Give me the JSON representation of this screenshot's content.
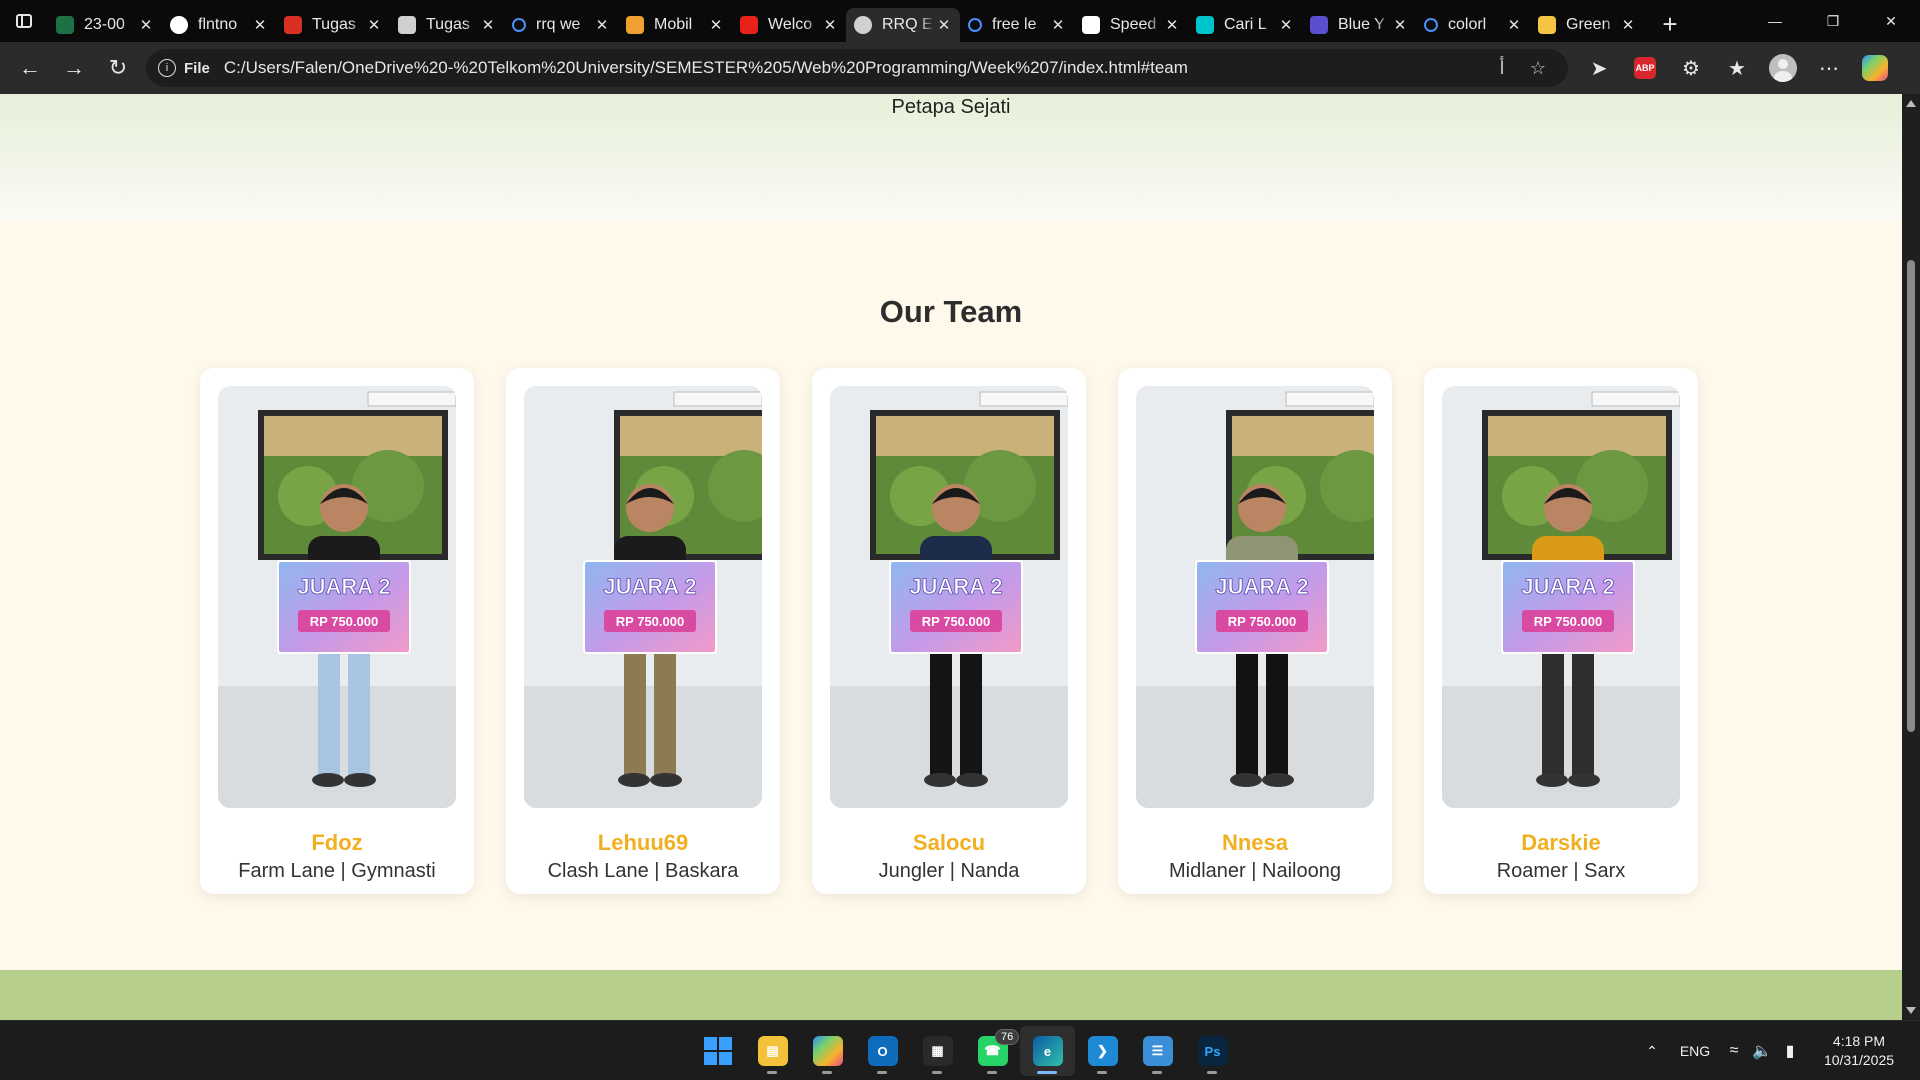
{
  "browser": {
    "tabs": [
      {
        "title": "23-00",
        "favicon": "forms-icon",
        "color": "#1e7145",
        "active": false
      },
      {
        "title": "flntno",
        "favicon": "github-icon",
        "color": "#ffffff",
        "active": false
      },
      {
        "title": "Tugas",
        "favicon": "pdf-icon",
        "color": "#d93025",
        "active": false
      },
      {
        "title": "Tugas",
        "favicon": "chatgpt-icon",
        "color": "#d0d0d0",
        "active": false
      },
      {
        "title": "rrq we",
        "favicon": "search-icon",
        "color": "#4a8df8",
        "active": false
      },
      {
        "title": "Mobil",
        "favicon": "mobile-legends-icon",
        "color": "#f0a030",
        "active": false
      },
      {
        "title": "Welco",
        "favicon": "adobe-icon",
        "color": "#e8221b",
        "active": false
      },
      {
        "title": "RRQ E",
        "favicon": "globe-icon",
        "color": "#d0d0d0",
        "active": true
      },
      {
        "title": "free le",
        "favicon": "search-icon",
        "color": "#4a8df8",
        "active": false
      },
      {
        "title": "Speed",
        "favicon": "speed-icon",
        "color": "#ffffff",
        "active": false
      },
      {
        "title": "Cari L",
        "favicon": "canva-icon",
        "color": "#00c4cc",
        "active": false
      },
      {
        "title": "Blue Y",
        "favicon": "canva-dark-icon",
        "color": "#5a4fcf",
        "active": false
      },
      {
        "title": "colorl",
        "favicon": "search-icon",
        "color": "#4a8df8",
        "active": false
      },
      {
        "title": "Green",
        "favicon": "colorhunt-icon",
        "color": "#f4c542",
        "active": false
      }
    ],
    "address": {
      "scheme_label": "File",
      "url": "C:/Users/Falen/OneDrive%20-%20Telkom%20University/SEMESTER%205/Web%20Programming/Week%207/index.html#team"
    }
  },
  "page": {
    "hero_tail_text": "Petapa Sejati",
    "team_heading": "Our Team",
    "members": [
      {
        "name": "Fdoz",
        "role": "Farm Lane | Gymnasti",
        "shirt": "#1a1a1a",
        "pants": "#a9c4e0"
      },
      {
        "name": "Lehuu69",
        "role": "Clash Lane | Baskara",
        "shirt": "#1b1b1b",
        "pants": "#8b7a52"
      },
      {
        "name": "Salocu",
        "role": "Jungler | Nanda",
        "shirt": "#1d2b4a",
        "pants": "#141414"
      },
      {
        "name": "Nnesa",
        "role": "Midlaner | Nailoong",
        "shirt": "#8f9474",
        "pants": "#121212"
      },
      {
        "name": "Darskie",
        "role": "Roamer | Sarx",
        "shirt": "#d99a18",
        "pants": "#2e2e2e"
      }
    ],
    "banner": {
      "title": "JUARA 2",
      "prize": "RP 750.000"
    },
    "colors": {
      "name_accent": "#f0b022",
      "section_bg": "#fff9ec",
      "footer_band": "#b6cf8c"
    }
  },
  "taskbar": {
    "apps": [
      {
        "name": "start-button",
        "active": false
      },
      {
        "name": "file-explorer",
        "active": false
      },
      {
        "name": "copilot-app",
        "active": false
      },
      {
        "name": "outlook",
        "active": false
      },
      {
        "name": "microsoft-store",
        "active": false
      },
      {
        "name": "whatsapp",
        "active": false,
        "badge": "76"
      },
      {
        "name": "edge",
        "active": true
      },
      {
        "name": "vscode",
        "active": false
      },
      {
        "name": "notepad",
        "active": false
      },
      {
        "name": "photoshop",
        "active": false
      }
    ],
    "tray": {
      "language": "ENG",
      "time": "4:18 PM",
      "date": "10/31/2025"
    }
  }
}
